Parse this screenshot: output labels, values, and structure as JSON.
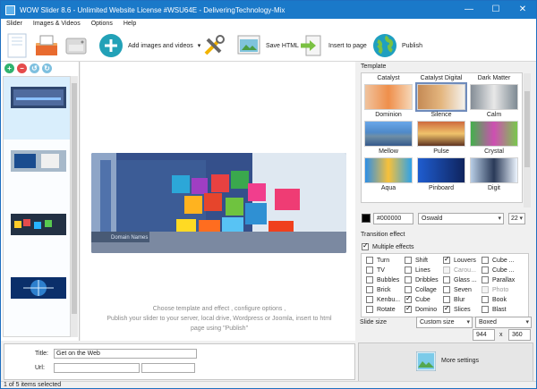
{
  "window": {
    "title": "WOW Slider 8.6 - Unlimited Website License #WSU64E - DeliveringTechnology-Mix",
    "close_glyph": "✕",
    "minimize_glyph": "—",
    "maximize_glyph": "☐"
  },
  "menu": {
    "items": [
      "Slider",
      "Images & Videos",
      "Options",
      "Help"
    ]
  },
  "toolbar": {
    "add_images_label": "Add images and videos",
    "save_html_label": "Save HTML",
    "insert_page_label": "Insert to page",
    "publish_label": "Publish"
  },
  "left": {
    "selected_index": 0
  },
  "preview": {
    "overlay_label": "Domain Names",
    "hint_line1": "Choose template and effect , configure options ,",
    "hint_line2": "Publish your slider to your server, local drive, Wordpress or Joomla, insert to html",
    "hint_line3": "page using   \"Publish\""
  },
  "template": {
    "section_label": "Template",
    "items": [
      {
        "name": "Catalyst",
        "selected": false
      },
      {
        "name": "Catalyst Digital",
        "selected": true
      },
      {
        "name": "Dark Matter",
        "selected": false
      },
      {
        "name": "Dominion",
        "selected": false
      },
      {
        "name": "Silence",
        "selected": false
      },
      {
        "name": "Calm",
        "selected": false
      },
      {
        "name": "Mellow",
        "selected": false
      },
      {
        "name": "Pulse",
        "selected": false
      },
      {
        "name": "Crystal",
        "selected": false
      },
      {
        "name": "Aqua",
        "selected": false
      },
      {
        "name": "Pinboard",
        "selected": false
      },
      {
        "name": "Digit",
        "selected": false
      }
    ],
    "color": "#000000",
    "font": "Oswald",
    "font_size": "22"
  },
  "transition": {
    "section_label": "Transition effect",
    "multiple_label": "Multiple effects",
    "multiple_checked": true,
    "effects": [
      {
        "name": "Turn",
        "checked": false,
        "disabled": false
      },
      {
        "name": "Shift",
        "checked": false,
        "disabled": false
      },
      {
        "name": "Louvers",
        "checked": true,
        "disabled": false
      },
      {
        "name": "Cube ...",
        "checked": false,
        "disabled": false
      },
      {
        "name": "TV",
        "checked": false,
        "disabled": false
      },
      {
        "name": "Lines",
        "checked": false,
        "disabled": false
      },
      {
        "name": "Carou...",
        "checked": false,
        "disabled": true
      },
      {
        "name": "Cube ...",
        "checked": false,
        "disabled": false
      },
      {
        "name": "Bubbles",
        "checked": false,
        "disabled": false
      },
      {
        "name": "Dribbles",
        "checked": false,
        "disabled": false
      },
      {
        "name": "Glass ...",
        "checked": false,
        "disabled": false
      },
      {
        "name": "Parallax",
        "checked": false,
        "disabled": false
      },
      {
        "name": "Brick",
        "checked": false,
        "disabled": false
      },
      {
        "name": "Collage",
        "checked": false,
        "disabled": false
      },
      {
        "name": "Seven",
        "checked": false,
        "disabled": false
      },
      {
        "name": "Photo",
        "checked": false,
        "disabled": true
      },
      {
        "name": "Kenbu...",
        "checked": false,
        "disabled": false
      },
      {
        "name": "Cube",
        "checked": true,
        "disabled": false
      },
      {
        "name": "Blur",
        "checked": false,
        "disabled": false
      },
      {
        "name": "Book",
        "checked": false,
        "disabled": false
      },
      {
        "name": "Rotate",
        "checked": false,
        "disabled": false
      },
      {
        "name": "Domino",
        "checked": true,
        "disabled": false
      },
      {
        "name": "Slices",
        "checked": true,
        "disabled": false
      },
      {
        "name": "Blast",
        "checked": false,
        "disabled": false
      }
    ]
  },
  "slide_size": {
    "label": "Slide size",
    "mode": "Custom size",
    "type": "Boxed",
    "width": "944",
    "height": "360",
    "times": "x"
  },
  "bottom": {
    "title_label": "Title:",
    "title_value": "Get on the Web",
    "url_label": "Url:",
    "url_value": "",
    "more_settings": "More settings"
  },
  "status": {
    "text": "1 of 5 items selected"
  }
}
